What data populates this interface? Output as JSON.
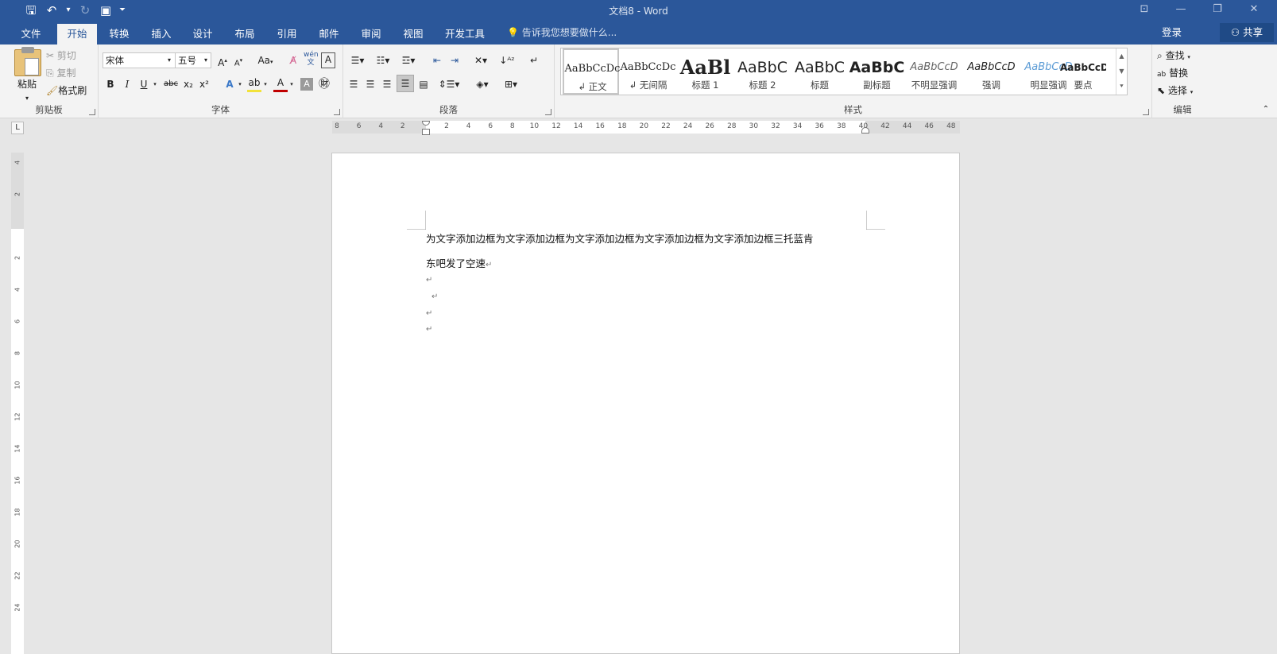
{
  "window": {
    "title": "文档8 - Word"
  },
  "qat": {
    "save_glyph": "🖫",
    "undo_glyph": "↶",
    "redo_glyph": "↻",
    "customize_glyph": "⏷",
    "touch_glyph": "▣"
  },
  "tabs": [
    "文件",
    "开始",
    "转换",
    "插入",
    "设计",
    "布局",
    "引用",
    "邮件",
    "审阅",
    "视图",
    "开发工具"
  ],
  "tell_me": "告诉我您想要做什么...",
  "account": {
    "login": "登录",
    "share": "共享"
  },
  "clipboard": {
    "paste": "粘贴",
    "cut": "剪切",
    "copy": "复制",
    "format_painter": "格式刷",
    "label": "剪贴板"
  },
  "font": {
    "name": "宋体",
    "size": "五号",
    "label": "字体",
    "aa": "Aa",
    "pinyin": "wén",
    "bold": "B",
    "italic": "I",
    "underline": "U",
    "strike": "abc",
    "sub": "x₂",
    "sup": "x²"
  },
  "paragraph": {
    "label": "段落"
  },
  "styles": {
    "label": "样式",
    "items": [
      {
        "sample": "AaBbCcDc",
        "name": "↲ 正文"
      },
      {
        "sample": "AaBbCcDc",
        "name": "↲ 无间隔"
      },
      {
        "sample": "AaBl",
        "name": "标题 1"
      },
      {
        "sample": "AaBbC",
        "name": "标题 2"
      },
      {
        "sample": "AaBbC",
        "name": "标题"
      },
      {
        "sample": "AaBbC",
        "name": "副标题"
      },
      {
        "sample": "AaBbCcD",
        "name": "不明显强调"
      },
      {
        "sample": "AaBbCcD",
        "name": "强调"
      },
      {
        "sample": "AaBbCcD",
        "name": "明显强调"
      },
      {
        "sample": "AaBbCcD",
        "name": "要点"
      }
    ]
  },
  "editing": {
    "find": "查找",
    "replace": "替换",
    "select": "选择",
    "label": "编辑"
  },
  "ruler": {
    "h_labels": [
      "8",
      "6",
      "4",
      "2",
      "",
      "2",
      "4",
      "6",
      "8",
      "10",
      "12",
      "14",
      "16",
      "18",
      "20",
      "22",
      "24",
      "26",
      "28",
      "30",
      "32",
      "34",
      "36",
      "38",
      "40",
      "42",
      "44",
      "46",
      "48"
    ],
    "v_labels": [
      "4",
      "2",
      "",
      "2",
      "4",
      "6",
      "8",
      "10",
      "12",
      "14",
      "16",
      "18",
      "20",
      "22",
      "24"
    ],
    "corner": "L"
  },
  "document": {
    "line1": "为文字添加边框为文字添加边框为文字添加边框为文字添加边框为文字添加边框三托蓝肯",
    "line2": "东吧发了空速",
    "para_mark": "↵"
  },
  "colors": {
    "title_blue": "#2b579a",
    "ribbon_bg": "#f3f3f3",
    "canvas": "#e6e6e6"
  }
}
